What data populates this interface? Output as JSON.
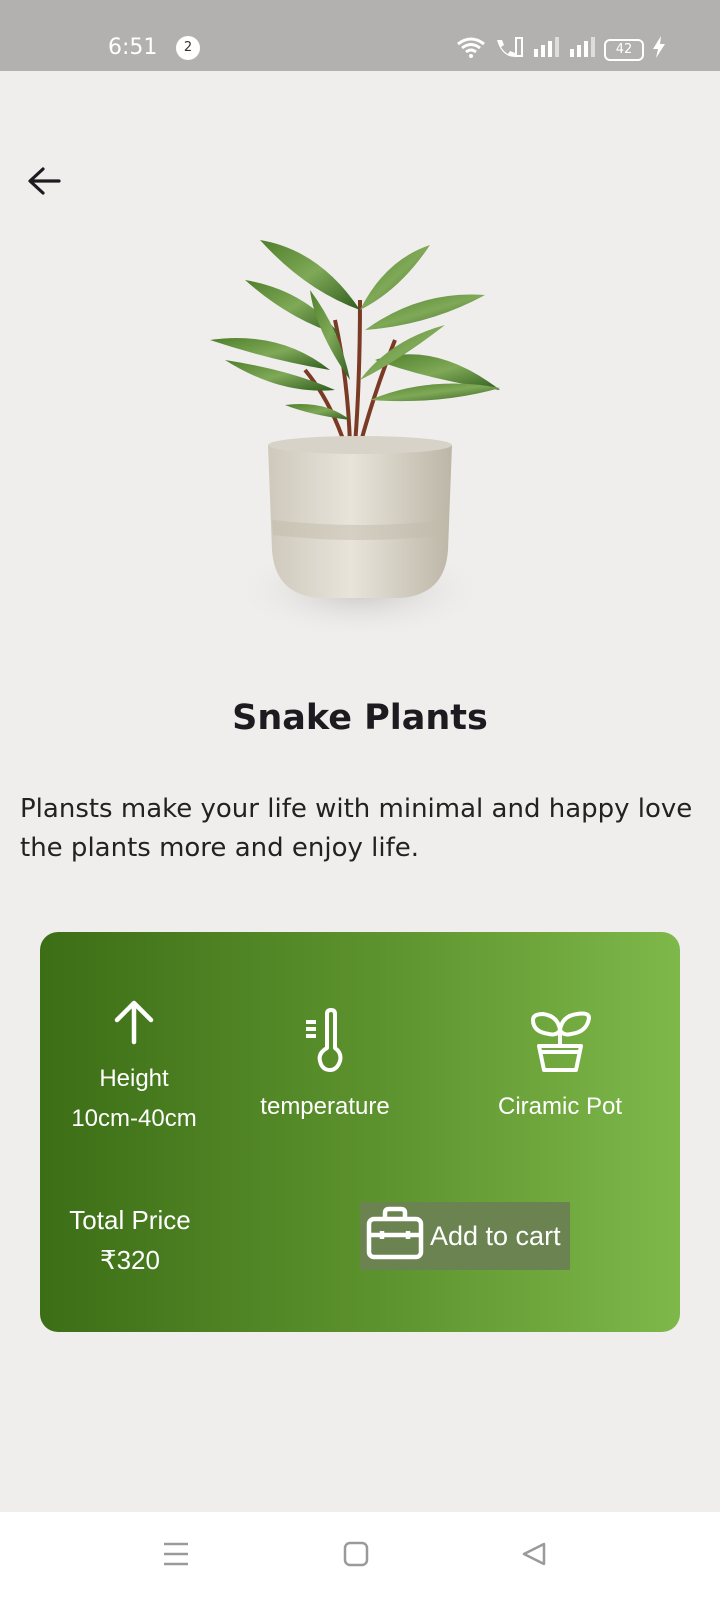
{
  "status_bar": {
    "time": "6:51",
    "notification_count": "2",
    "battery": "42"
  },
  "product": {
    "name": "Snake Plants",
    "description": "Plansts make your life with minimal and happy love the plants more and enjoy life."
  },
  "features": {
    "height_label": "Height",
    "height_value": "10cm-40cm",
    "temperature_label": "temperature",
    "pot_label": "Ciramic Pot"
  },
  "price": {
    "label": "Total Price",
    "value": "₹320"
  },
  "cart": {
    "button_label": "Add to cart"
  },
  "icons": {
    "back": "arrow-left-icon",
    "height": "arrow-up-icon",
    "temperature": "thermometer-icon",
    "pot": "plant-pot-icon",
    "cart": "briefcase-icon",
    "nav_menu": "menu-icon",
    "nav_home": "home-square-icon",
    "nav_back": "back-triangle-icon"
  },
  "colors": {
    "card_start": "#3c6e16",
    "card_end": "#7eb84a",
    "background": "#efeeed",
    "status_bar": "#b2b1b0"
  }
}
